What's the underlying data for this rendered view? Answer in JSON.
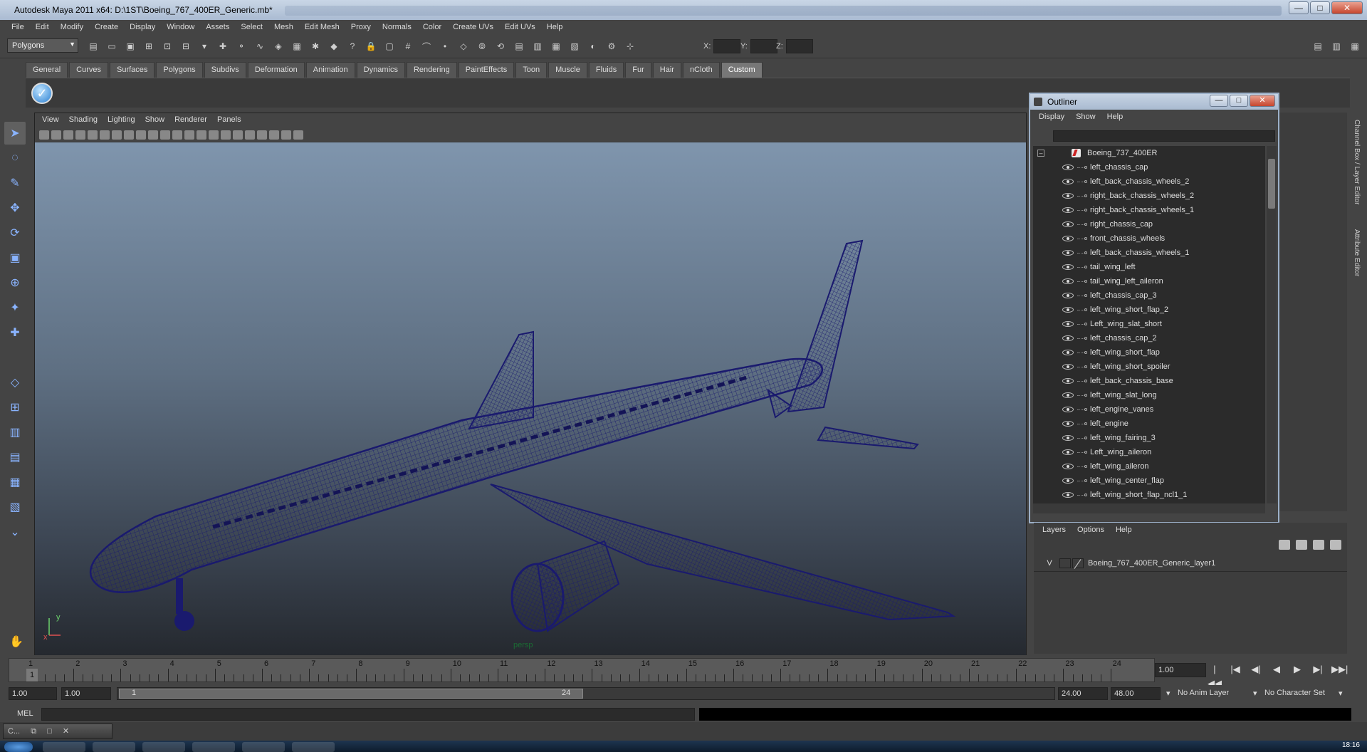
{
  "window": {
    "title": "Autodesk Maya 2011 x64: D:\\1ST\\Boeing_767_400ER_Generic.mb*",
    "min": "—",
    "max": "□",
    "close": "✕"
  },
  "menubar": [
    "File",
    "Edit",
    "Modify",
    "Create",
    "Display",
    "Window",
    "Assets",
    "Select",
    "Mesh",
    "Edit Mesh",
    "Proxy",
    "Normals",
    "Color",
    "Create UVs",
    "Edit UVs",
    "Help"
  ],
  "status": {
    "mode": "Polygons",
    "x_label": "X:",
    "y_label": "Y:",
    "z_label": "Z:"
  },
  "shelf": {
    "tabs": [
      "General",
      "Curves",
      "Surfaces",
      "Polygons",
      "Subdivs",
      "Deformation",
      "Animation",
      "Dynamics",
      "Rendering",
      "PaintEffects",
      "Toon",
      "Muscle",
      "Fluids",
      "Fur",
      "Hair",
      "nCloth",
      "Custom"
    ],
    "active": "Custom"
  },
  "viewport": {
    "menu": [
      "View",
      "Shading",
      "Lighting",
      "Show",
      "Renderer",
      "Panels"
    ],
    "camera": "persp",
    "axis_x": "x",
    "axis_y": "y",
    "wire_color": "#1a1a6e"
  },
  "outliner": {
    "title": "Outliner",
    "menu": [
      "Display",
      "Show",
      "Help"
    ],
    "root": "Boeing_737_400ER",
    "items": [
      "left_chassis_cap",
      "left_back_chassis_wheels_2",
      "right_back_chassis_wheels_2",
      "right_back_chassis_wheels_1",
      "right_chassis_cap",
      "front_chassis_wheels",
      "left_back_chassis_wheels_1",
      "tail_wing_left",
      "tail_wing_left_aileron",
      "left_chassis_cap_3",
      "left_wing_short_flap_2",
      "Left_wing_slat_short",
      "left_chassis_cap_2",
      "left_wing_short_flap",
      "left_wing_short_spoiler",
      "left_back_chassis_base",
      "left_wing_slat_long",
      "left_engine_vanes",
      "left_engine",
      "left_wing_fairing_3",
      "Left_wing_aileron",
      "left_wing_aileron",
      "left_wing_center_flap",
      "left_wing_short_flap_ncl1_1"
    ]
  },
  "layers": {
    "menu": [
      "Layers",
      "Options",
      "Help"
    ],
    "visible": "V",
    "layer_name": "Boeing_767_400ER_Generic_layer1"
  },
  "side_tabs": [
    "Channel Box / Layer Editor",
    "Attribute Editor"
  ],
  "timeline": {
    "frames": [
      "1",
      "2",
      "3",
      "4",
      "5",
      "6",
      "7",
      "8",
      "9",
      "10",
      "11",
      "12",
      "13",
      "14",
      "15",
      "16",
      "17",
      "18",
      "19",
      "20",
      "21",
      "22",
      "23",
      "24"
    ],
    "current": "1",
    "current_field": "1.00"
  },
  "playback": [
    "|◀◀",
    "|◀",
    "◀|",
    "◀",
    "▶",
    "▶|",
    "▶▶|"
  ],
  "range": {
    "start_time": "1.00",
    "playback_start": "1.00",
    "slider_start": "1",
    "slider_end": "24",
    "playback_end": "24.00",
    "end_time": "48.00",
    "anim_layer": "No Anim Layer",
    "char_set": "No Character Set"
  },
  "cmdline": {
    "label": "MEL"
  },
  "minibar": {
    "label": "C...",
    "restore": "⧉",
    "max": "□",
    "close": "✕"
  },
  "clock": "18:16"
}
